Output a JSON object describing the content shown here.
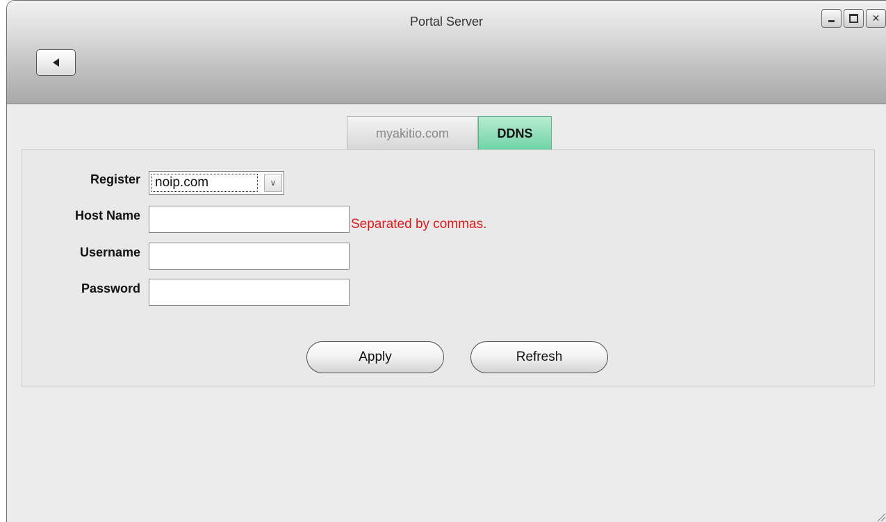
{
  "window": {
    "title": "Portal Server"
  },
  "tabs": [
    {
      "label": "myakitio.com",
      "active": false
    },
    {
      "label": "DDNS",
      "active": true
    }
  ],
  "form": {
    "register_label": "Register",
    "register_value": "noip.com",
    "host_label": "Host Name",
    "host_value": "",
    "host_hint": "Separated by commas.",
    "username_label": "Username",
    "username_value": "",
    "password_label": "Password",
    "password_value": ""
  },
  "buttons": {
    "apply": "Apply",
    "refresh": "Refresh"
  },
  "colors": {
    "active_tab": "#6fd3a5",
    "hint": "#e01a1a"
  }
}
